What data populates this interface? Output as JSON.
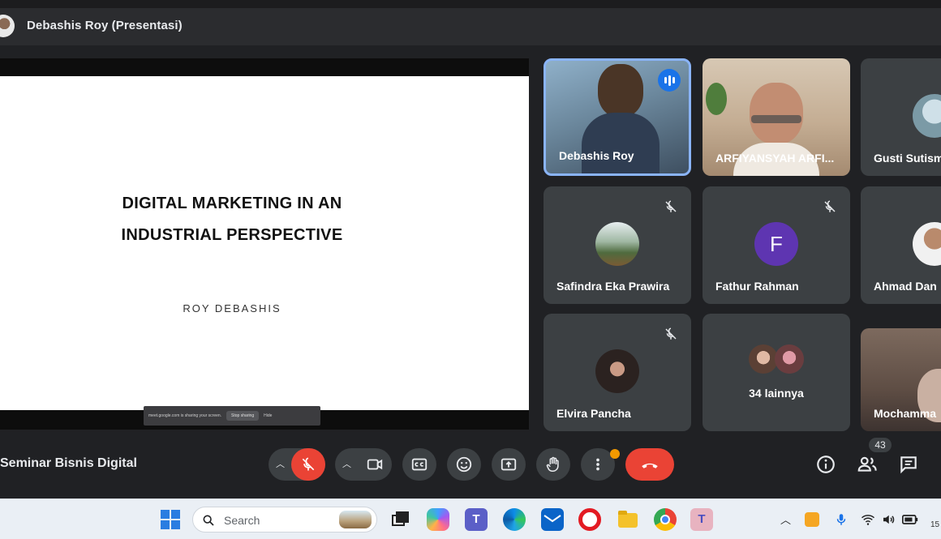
{
  "header": {
    "presenter_label": "Debashis Roy (Presentasi)"
  },
  "slide": {
    "title_line1": "DIGITAL MARKETING IN AN",
    "title_line2": "INDUSTRIAL PERSPECTIVE",
    "author": "ROY DEBASHIS"
  },
  "share_bar": {
    "message": "meet.google.com is sharing your screen.",
    "stop_label": "Stop sharing",
    "hide_label": "Hide"
  },
  "participants": [
    {
      "name": "Debashis Roy",
      "speaking": true
    },
    {
      "name": "ARFIYANSYAH ARFI..."
    },
    {
      "name": "Gusti Sutism"
    },
    {
      "name": "Safindra Eka Prawira",
      "muted": true
    },
    {
      "name": "Fathur Rahman",
      "initial": "F",
      "avatar_color": "#5e35b1",
      "muted": true
    },
    {
      "name": "Ahmad Dan"
    },
    {
      "name": "Elvira Pancha",
      "muted": true
    },
    {
      "name": "34 lainnya"
    },
    {
      "name": "Mochamma"
    }
  ],
  "meeting": {
    "title": "Seminar Bisnis Digital",
    "participant_count": "43"
  },
  "taskbar": {
    "search_placeholder": "Search",
    "clock": "15"
  },
  "colors": {
    "end_call": "#ea4335",
    "accent": "#8ab4f8",
    "notification_dot": "#f29900"
  }
}
